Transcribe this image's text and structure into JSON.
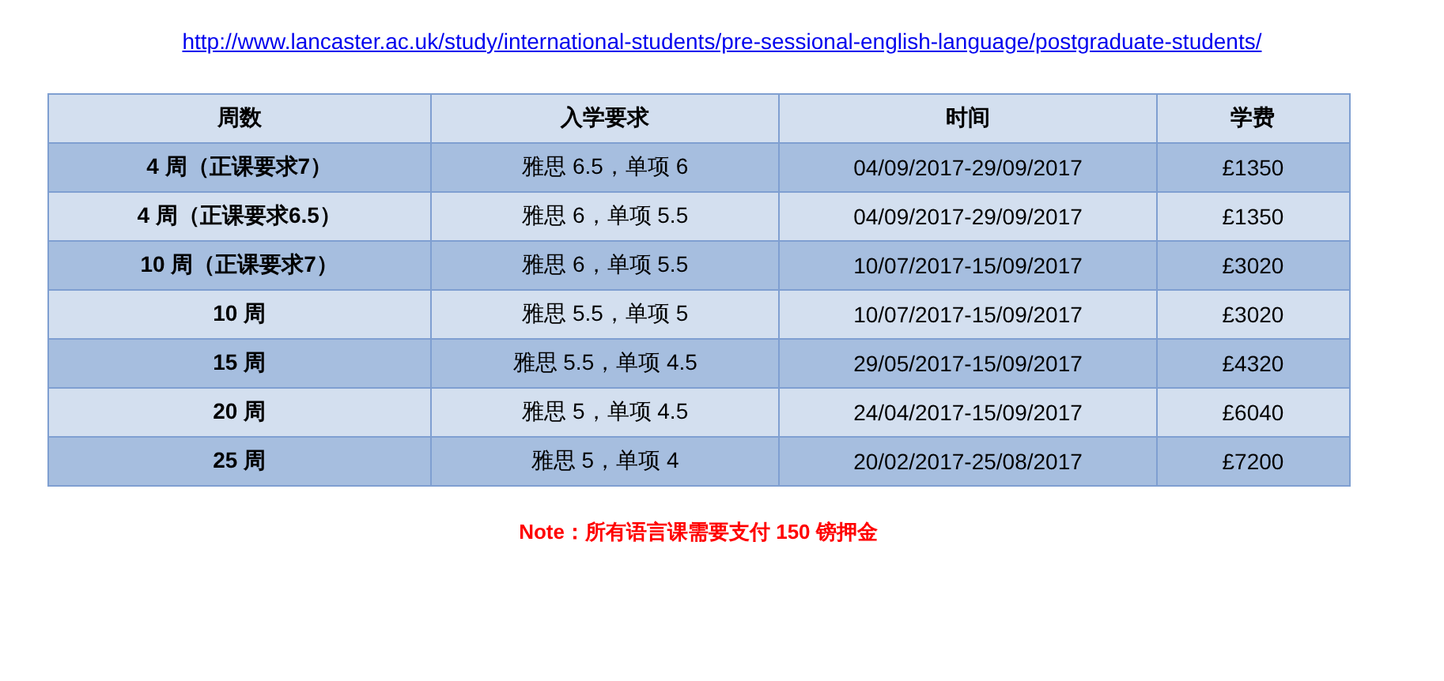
{
  "link": "http://www.lancaster.ac.uk/study/international-students/pre-sessional-english-language/postgraduate-students/",
  "table": {
    "columns": [
      "周数",
      "入学要求",
      "时间",
      "学费"
    ],
    "rows": [
      [
        "4 周（正课要求7）",
        "雅思 6.5，单项 6",
        "04/09/2017-29/09/2017",
        "£1350"
      ],
      [
        "4 周（正课要求6.5）",
        "雅思 6，单项 5.5",
        "04/09/2017-29/09/2017",
        "£1350"
      ],
      [
        "10 周（正课要求7）",
        "雅思 6，单项 5.5",
        "10/07/2017-15/09/2017",
        "£3020"
      ],
      [
        "10 周",
        "雅思 5.5，单项 5",
        "10/07/2017-15/09/2017",
        "£3020"
      ],
      [
        "15 周",
        "雅思 5.5，单项 4.5",
        "29/05/2017-15/09/2017",
        "£4320"
      ],
      [
        "20 周",
        "雅思 5，单项 4.5",
        "24/04/2017-15/09/2017",
        "£6040"
      ],
      [
        "25 周",
        "雅思 5，单项 4",
        "20/02/2017-25/08/2017",
        "£7200"
      ]
    ]
  },
  "note": "Note：所有语言课需要支付 150 镑押金"
}
